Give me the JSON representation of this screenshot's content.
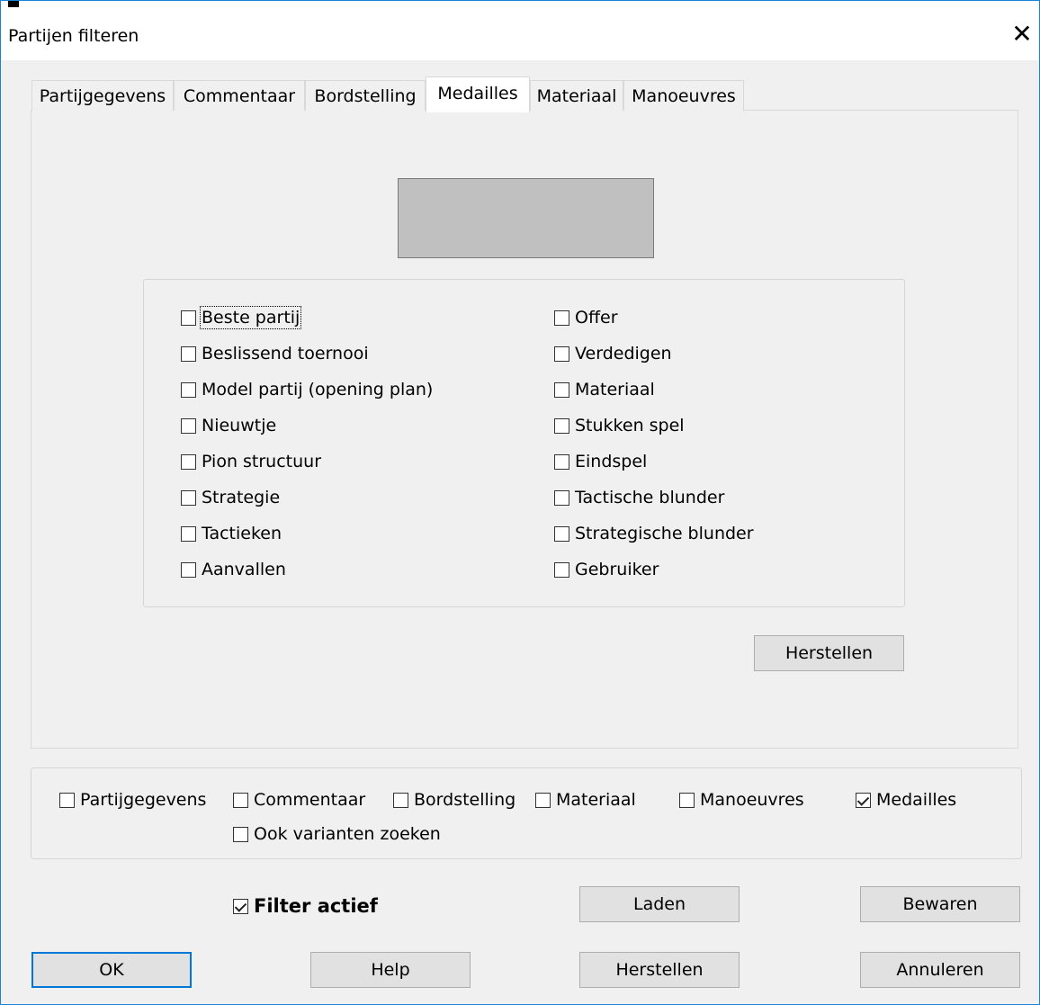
{
  "window": {
    "title": "Partijen filteren",
    "close_glyph": "✕"
  },
  "tabs": [
    {
      "label": "Partijgegevens",
      "active": false
    },
    {
      "label": "Commentaar",
      "active": false
    },
    {
      "label": "Bordstelling",
      "active": false
    },
    {
      "label": "Medailles",
      "active": true
    },
    {
      "label": "Materiaal",
      "active": false
    },
    {
      "label": "Manoeuvres",
      "active": false
    }
  ],
  "medals": {
    "left": [
      {
        "label": "Beste partij",
        "checked": false,
        "focused": true
      },
      {
        "label": "Beslissend toernooi",
        "checked": false
      },
      {
        "label": "Model partij (opening plan)",
        "checked": false
      },
      {
        "label": "Nieuwtje",
        "checked": false
      },
      {
        "label": "Pion structuur",
        "checked": false
      },
      {
        "label": "Strategie",
        "checked": false
      },
      {
        "label": "Tactieken",
        "checked": false
      },
      {
        "label": "Aanvallen",
        "checked": false
      }
    ],
    "right": [
      {
        "label": "Offer",
        "checked": false
      },
      {
        "label": "Verdedigen",
        "checked": false
      },
      {
        "label": "Materiaal",
        "checked": false
      },
      {
        "label": "Stukken spel",
        "checked": false
      },
      {
        "label": "Eindspel",
        "checked": false
      },
      {
        "label": "Tactische blunder",
        "checked": false
      },
      {
        "label": "Strategische blunder",
        "checked": false
      },
      {
        "label": "Gebruiker",
        "checked": false
      }
    ],
    "reset_label": "Herstellen"
  },
  "scope": {
    "items": [
      {
        "label": "Partijgegevens",
        "checked": false
      },
      {
        "label": "Commentaar",
        "checked": false
      },
      {
        "label": "Bordstelling",
        "checked": false
      },
      {
        "label": "Materiaal",
        "checked": false
      },
      {
        "label": "Manoeuvres",
        "checked": false
      },
      {
        "label": "Medailles",
        "checked": true
      }
    ],
    "variants_label": "Ook varianten zoeken",
    "variants_checked": false
  },
  "filter": {
    "active_label": "Filter actief",
    "active_checked": true
  },
  "buttons": {
    "load": "Laden",
    "save": "Bewaren",
    "ok": "OK",
    "help": "Help",
    "reset": "Herstellen",
    "cancel": "Annuleren"
  }
}
